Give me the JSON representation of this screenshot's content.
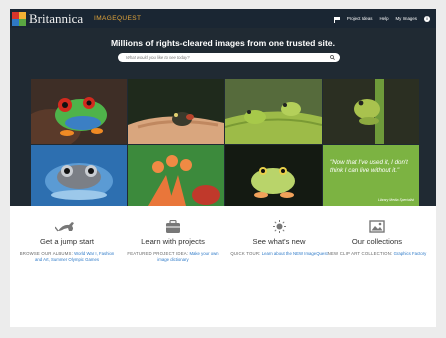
{
  "header": {
    "brand": "Britannica",
    "brand_sub": "IMAGEQUEST",
    "nav": [
      "Project Ideas",
      "Help",
      "My Images"
    ],
    "icons": {
      "flag": "flag-icon",
      "info": "info-icon"
    },
    "colors": {
      "bar": "#1a2633",
      "brand_sub": "#e4a63b"
    }
  },
  "hero": {
    "headline": "Millions of rights-cleared images from one trusted site.",
    "search_placeholder": "What would you like to see today?",
    "quote": "\"Now that I've used it, I don't think I can live without it.\"",
    "quote_credit": "Library Media Specialist",
    "colors": {
      "background": "#202a33",
      "quote_tile": "#7cb342"
    }
  },
  "features": [
    {
      "icon": "kangaroo-icon",
      "title": "Get a jump start",
      "lead": "BROWSE OUR ALBUMS:",
      "link": "World War I, Fashion and Art, Summer Olympic Games"
    },
    {
      "icon": "briefcase-icon",
      "title": "Learn with projects",
      "lead": "FEATURED PROJECT IDEA:",
      "link": "Make your own image dictionary"
    },
    {
      "icon": "sun-icon",
      "title": "See what's new",
      "lead": "QUICK TOUR:",
      "link": "Learn about the NEW ImageQuest"
    },
    {
      "icon": "image-icon",
      "title": "Our collections",
      "lead": "NEW CLIP ART COLLECTION:",
      "link": "Graphics Factory"
    }
  ]
}
